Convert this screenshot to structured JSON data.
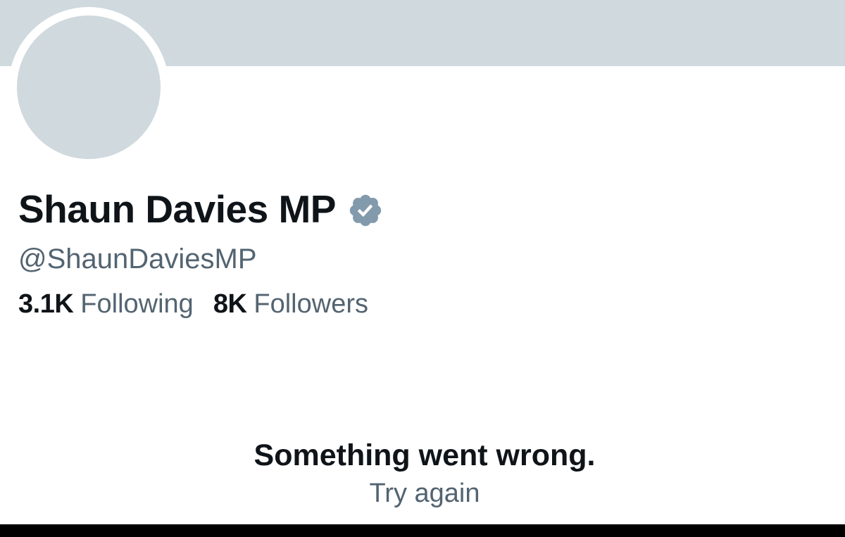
{
  "profile": {
    "display_name": "Shaun Davies MP",
    "handle": "@ShaunDaviesMP",
    "verified_icon": "verified-badge-icon",
    "stats": {
      "following_count": "3.1K",
      "following_label": "Following",
      "followers_count": "8K",
      "followers_label": "Followers"
    }
  },
  "error": {
    "title": "Something went wrong.",
    "retry_label": "Try again"
  },
  "colors": {
    "banner": "#cfd9de",
    "avatar_placeholder": "#cfd9de",
    "primary_text": "#0f1419",
    "secondary_text": "#536471",
    "verified_badge": "#829aab"
  }
}
